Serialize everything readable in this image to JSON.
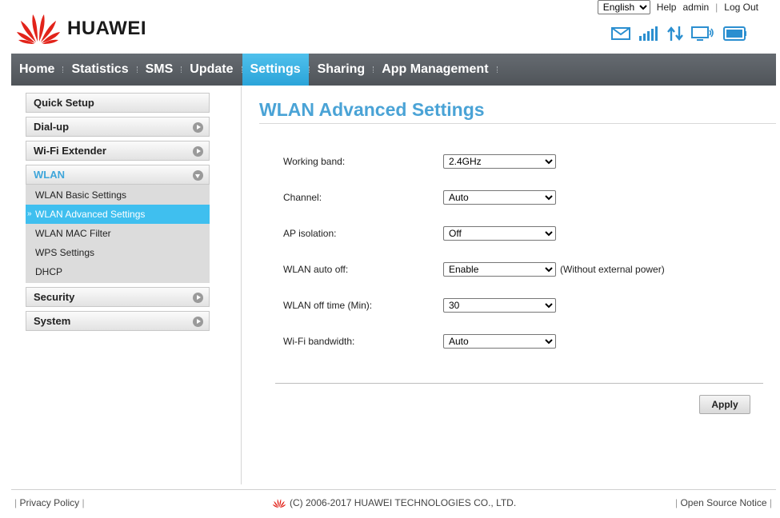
{
  "brand": {
    "name": "HUAWEI"
  },
  "topbar": {
    "language": "English",
    "language_options": [
      "English"
    ],
    "help": "Help",
    "user": "admin",
    "logout": "Log Out"
  },
  "status_icons": [
    "mail-icon",
    "signal-strength-icon",
    "data-transfer-icon",
    "pc-connection-icon",
    "battery-icon"
  ],
  "nav": {
    "items": [
      {
        "label": "Home"
      },
      {
        "label": "Statistics"
      },
      {
        "label": "SMS"
      },
      {
        "label": "Update"
      },
      {
        "label": "Settings",
        "active": true
      },
      {
        "label": "Sharing"
      },
      {
        "label": "App Management"
      }
    ]
  },
  "sidebar": {
    "quick_setup": "Quick Setup",
    "dialup": "Dial-up",
    "wifi_extender": "Wi-Fi Extender",
    "wlan": "WLAN",
    "wlan_items": [
      {
        "label": "WLAN Basic Settings"
      },
      {
        "label": "WLAN Advanced Settings",
        "active": true
      },
      {
        "label": "WLAN MAC Filter"
      },
      {
        "label": "WPS Settings"
      },
      {
        "label": "DHCP"
      }
    ],
    "security": "Security",
    "system": "System"
  },
  "main": {
    "title": "WLAN Advanced Settings",
    "fields": [
      {
        "label": "Working band:",
        "value": "2.4GHz"
      },
      {
        "label": "Channel:",
        "value": "Auto"
      },
      {
        "label": "AP isolation:",
        "value": "Off"
      },
      {
        "label": "WLAN auto off:",
        "value": "Enable",
        "note": "(Without external power)"
      },
      {
        "label": "WLAN off time (Min):",
        "value": "30"
      },
      {
        "label": "Wi-Fi bandwidth:",
        "value": "Auto"
      }
    ],
    "apply": "Apply"
  },
  "footer": {
    "privacy": "Privacy Policy",
    "copyright": "(C) 2006-2017 HUAWEI TECHNOLOGIES CO., LTD.",
    "open_source": "Open Source Notice"
  },
  "colors": {
    "accent": "#3fbfef",
    "title": "#4aa3d6",
    "nav_bg": "#5b6066",
    "brand_red": "#e2231a"
  }
}
